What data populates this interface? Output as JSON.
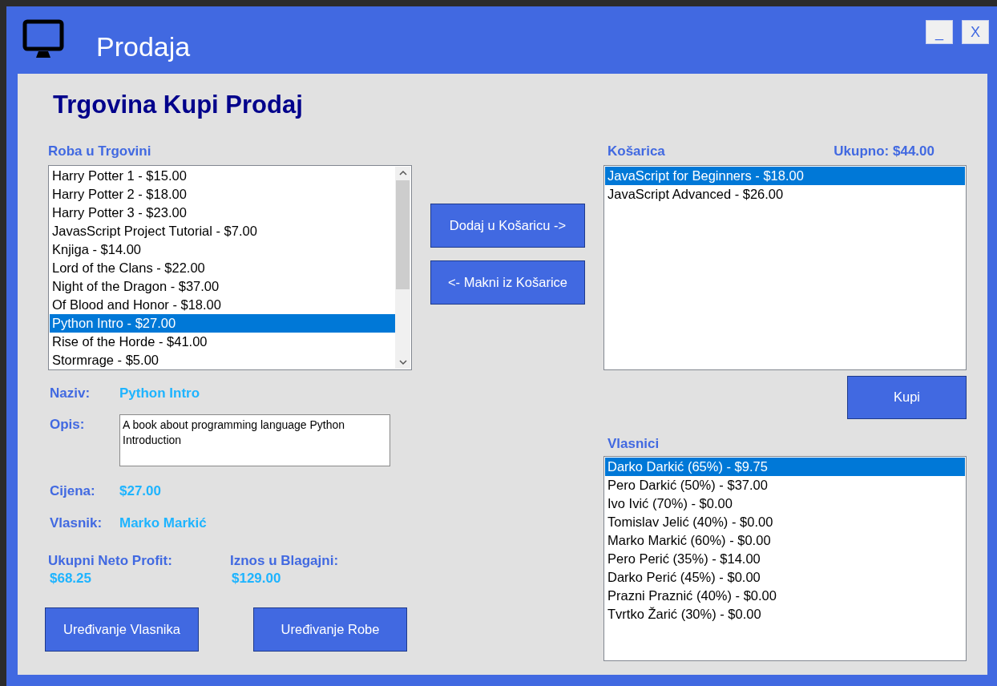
{
  "window": {
    "title": "Prodaja",
    "buttons": [
      "_",
      "X"
    ]
  },
  "heading": "Trgovina Kupi Prodaj",
  "store": {
    "label": "Roba u Trgovini",
    "items": [
      {
        "text": "Harry Potter 1 - $15.00",
        "selected": false
      },
      {
        "text": "Harry Potter 2 - $18.00",
        "selected": false
      },
      {
        "text": "Harry Potter 3 - $23.00",
        "selected": false
      },
      {
        "text": "JavasScript Project Tutorial - $7.00",
        "selected": false
      },
      {
        "text": "Knjiga - $14.00",
        "selected": false
      },
      {
        "text": "Lord of the Clans - $22.00",
        "selected": false
      },
      {
        "text": "Night of the Dragon - $37.00",
        "selected": false
      },
      {
        "text": "Of Blood and Honor - $18.00",
        "selected": false
      },
      {
        "text": "Python Intro - $27.00",
        "selected": true
      },
      {
        "text": "Rise of the Horde - $41.00",
        "selected": false
      },
      {
        "text": "Stormrage - $5.00",
        "selected": false
      }
    ]
  },
  "transfer_buttons": [
    "Dodaj u Košaricu ->",
    "<- Makni iz Košarice"
  ],
  "cart": {
    "label": "Košarica",
    "total": "Ukupno: $44.00",
    "items": [
      {
        "text": "JavaScript for Beginners - $18.00",
        "selected": true
      },
      {
        "text": "JavaScript Advanced - $26.00",
        "selected": false
      }
    ]
  },
  "buy_button": "Kupi",
  "details": [
    {
      "kind": "text",
      "label": "Naziv:",
      "value": "Python Intro"
    },
    {
      "kind": "textarea",
      "label": "Opis:",
      "value": "A book about programming language Python Introduction"
    },
    {
      "kind": "text",
      "label": "Cijena:",
      "value": "$27.00"
    },
    {
      "kind": "text",
      "label": "Vlasnik:",
      "value": "Marko Markić"
    }
  ],
  "stats": [
    {
      "label": "Ukupni Neto Profit:",
      "value": "$68.25"
    },
    {
      "label": "Iznos u Blagajni:",
      "value": "$129.00"
    }
  ],
  "bottom_buttons": [
    "Uređivanje Vlasnika",
    "Uređivanje Robe"
  ],
  "owners": {
    "label": "Vlasnici",
    "items": [
      {
        "text": "Darko Darkić (65%) - $9.75",
        "selected": true
      },
      {
        "text": "Pero Darkić (50%) - $37.00",
        "selected": false
      },
      {
        "text": "Ivo Ivić (70%) - $0.00",
        "selected": false
      },
      {
        "text": "Tomislav Jelić (40%) - $0.00",
        "selected": false
      },
      {
        "text": "Marko Markić (60%) - $0.00",
        "selected": false
      },
      {
        "text": "Pero Perić (35%) - $14.00",
        "selected": false
      },
      {
        "text": "Darko Perić (45%) - $0.00",
        "selected": false
      },
      {
        "text": "Prazni Praznić (40%) - $0.00",
        "selected": false
      },
      {
        "text": "Tvrtko Žarić (30%) - $0.00",
        "selected": false
      }
    ]
  }
}
